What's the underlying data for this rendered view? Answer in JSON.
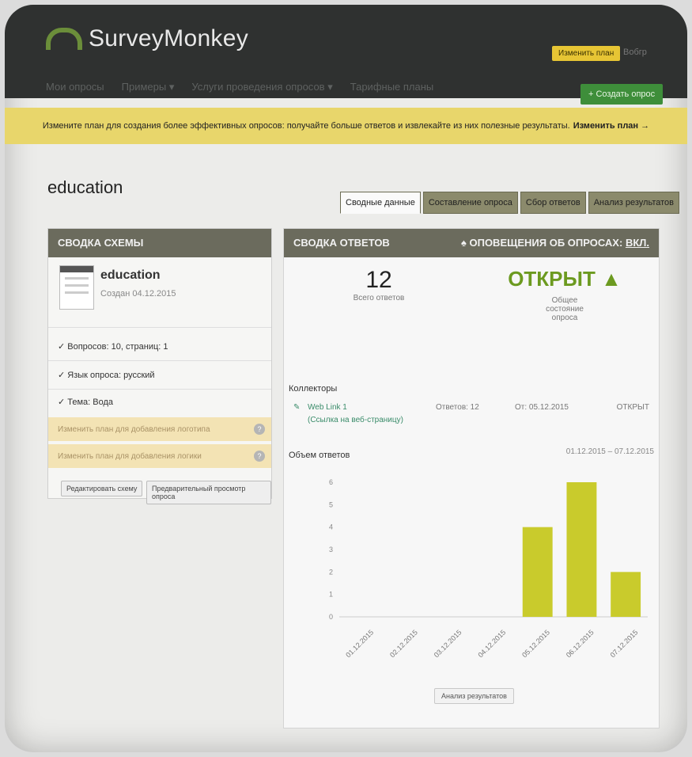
{
  "header": {
    "logo_text": "SurveyMonkey",
    "upgrade_label": "Изменить план",
    "user_link": "Вобгр",
    "nav": [
      "Мои опросы",
      "Примеры ▾",
      "Услуги проведения опросов ▾",
      "Тарифные планы"
    ],
    "create_label": "+ Создать опрос"
  },
  "banner": {
    "text": "Измените план для создания более эффективных опросов: получайте больше ответов и извлекайте из них полезные результаты.",
    "link": "Изменить план →"
  },
  "page": {
    "title": "education",
    "tabs": [
      "Сводные данные",
      "Составление опроса",
      "Сбор ответов",
      "Анализ результатов"
    ]
  },
  "schema": {
    "header": "СВОДКА СХЕМЫ",
    "title": "education",
    "created": "Создан 04.12.2015",
    "checks": [
      "✓ Вопросов: 10, страниц: 1",
      "✓ Язык опроса: русский",
      "✓ Тема: Вода"
    ],
    "warnings": [
      "Изменить план для добавления логотипа",
      "Изменить план для добавления логики"
    ],
    "edit_button": "Редактировать схему",
    "preview_button": "Предварительный просмотр опроса"
  },
  "responses": {
    "header": "СВОДКА ОТВЕТОВ",
    "alerts_label": "♠ ОПОВЕЩЕНИЯ ОБ ОПРОСАХ:",
    "alerts_value": "ВКЛ.",
    "total": "12",
    "total_label": "Всего ответов",
    "status": "ОТКРЫТ",
    "status_label": "Общее состояние опроса",
    "collectors_title": "Коллекторы",
    "collector": {
      "name": "Web Link 1",
      "type": "(Ссылка на веб-страницу)",
      "responses": "Ответов: 12",
      "from": "От: 05.12.2015",
      "status": "ОТКРЫТ"
    },
    "volume_title": "Объем ответов",
    "range": "01.12.2015 – 07.12.2015",
    "analyze_button": "Анализ результатов"
  },
  "chart_data": {
    "type": "bar",
    "categories": [
      "01.12.2015",
      "02.12.2015",
      "03.12.2015",
      "04.12.2015",
      "05.12.2015",
      "06.12.2015",
      "07.12.2015"
    ],
    "values": [
      0,
      0,
      0,
      0,
      4,
      6,
      2
    ],
    "ylim": [
      0,
      6
    ],
    "yticks": [
      0,
      1,
      2,
      3,
      4,
      5,
      6
    ],
    "color": "#c9cb2c"
  },
  "colors": {
    "header_bg": "#2f3130",
    "banner_bg": "#e8d66b",
    "panel_head": "#6b6b5d",
    "accent_green": "#3e8e3a",
    "status_green": "#6c9a20"
  }
}
